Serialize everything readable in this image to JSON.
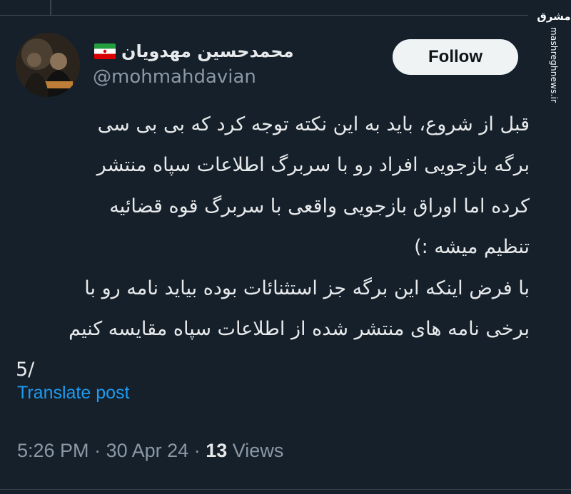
{
  "watermark": {
    "logo": "مشرق",
    "site": "mashreghnews.ir"
  },
  "author": {
    "display_name": "محمدحسین مهدویان",
    "handle": "@mohmahdavian"
  },
  "follow_label": "Follow",
  "tweet": {
    "lines": [
      "قبل از شروع، باید به این نکته توجه کرد که بی بی سی",
      "برگه بازجویی افراد رو با سربرگ اطلاعات سپاه منتشر",
      "کرده اما اوراق بازجویی واقعی با سربرگ قوه قضائیه",
      "تنظیم میشه :)",
      "با فرض اینکه این برگه جز استثنائات بوده بیاید نامه رو با",
      "برخی نامه های منتشر شده از اطلاعات سپاه مقایسه کنیم"
    ],
    "thread_marker": "5/"
  },
  "translate_label": "Translate post",
  "meta": {
    "time": "5:26 PM",
    "separator": "·",
    "date": "30 Apr 24",
    "views_count": "13",
    "views_label": "Views"
  },
  "colors": {
    "background": "#15202b",
    "text": "#e7e9ea",
    "muted": "#8b98a5",
    "link": "#1d9bf0",
    "button_bg": "#eff3f4"
  },
  "icons": {
    "flag": "iran-flag-icon"
  }
}
